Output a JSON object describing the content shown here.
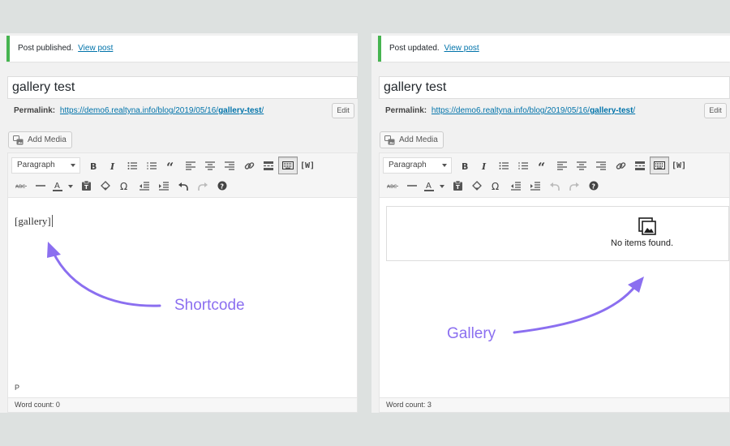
{
  "left_panel": {
    "notice": {
      "text": "Post published.",
      "link": "View post"
    },
    "title": "gallery test",
    "permalink": {
      "label": "Permalink:",
      "url_prefix": "https://demo6.realtyna.info/blog/2019/05/16/",
      "slug": "gallery-test",
      "url_suffix": "/"
    },
    "edit_label": "Edit",
    "add_media_label": "Add Media",
    "format_select": "Paragraph",
    "content": "[gallery]",
    "path": "P",
    "word_count": "Word count: 0"
  },
  "right_panel": {
    "notice": {
      "text": "Post updated.",
      "link": "View post"
    },
    "title": "gallery test",
    "permalink": {
      "label": "Permalink:",
      "url_prefix": "https://demo6.realtyna.info/blog/2019/05/16/",
      "slug": "gallery-test",
      "url_suffix": "/"
    },
    "edit_label": "Edit",
    "add_media_label": "Add Media",
    "format_select": "Paragraph",
    "gallery_message": "No items found.",
    "word_count": "Word count: 3"
  },
  "annotations": {
    "shortcode": "Shortcode",
    "gallery": "Gallery"
  },
  "colors": {
    "annotation": "#8b6ff0",
    "notice_border": "#46b450",
    "link": "#0073aa"
  }
}
